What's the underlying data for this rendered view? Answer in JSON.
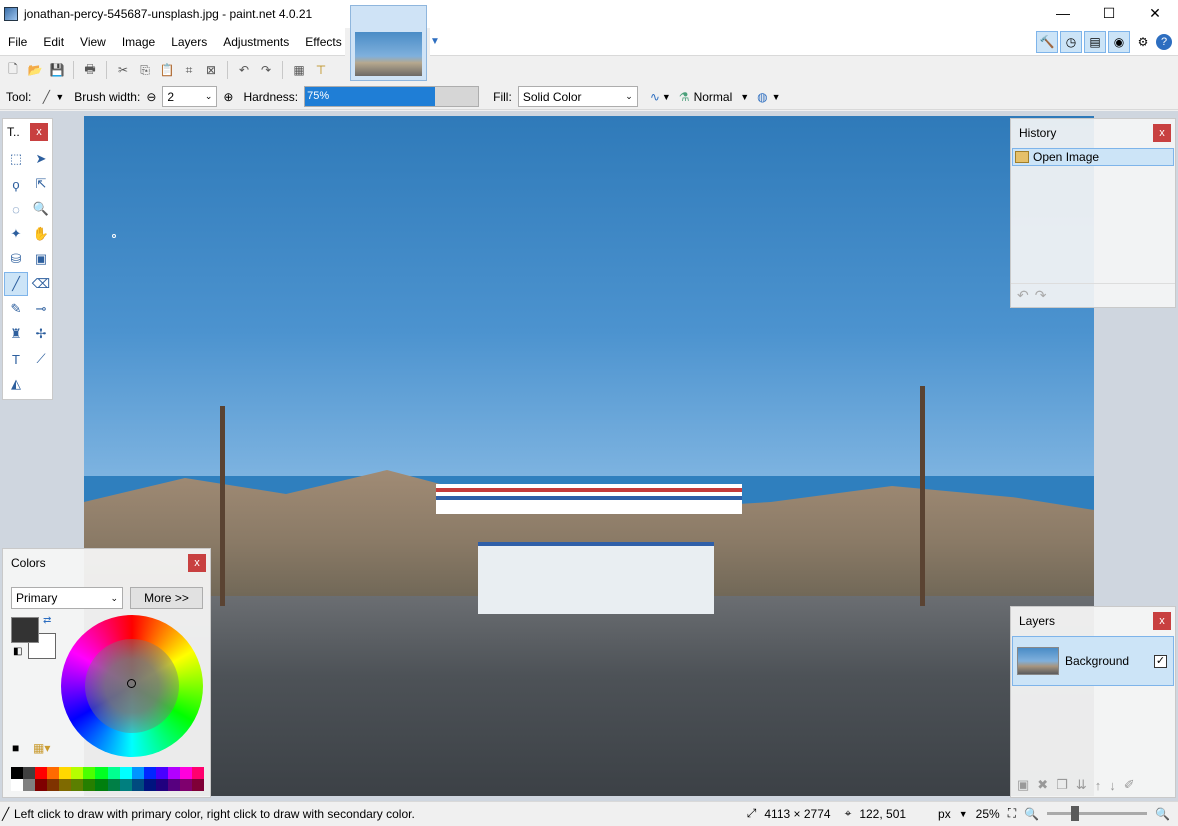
{
  "window": {
    "title": "jonathan-percy-545687-unsplash.jpg - paint.net 4.0.21",
    "minimize": "—",
    "maximize": "☐",
    "close": "✕"
  },
  "menu": [
    "File",
    "Edit",
    "View",
    "Image",
    "Layers",
    "Adjustments",
    "Effects"
  ],
  "toolbar2": {
    "tool_label": "Tool:",
    "brush_width_label": "Brush width:",
    "brush_width_value": "2",
    "hardness_label": "Hardness:",
    "hardness_value": "75%",
    "hardness_fraction": 0.75,
    "fill_label": "Fill:",
    "fill_value": "Solid Color",
    "blend_mode": "Normal"
  },
  "tools_panel": {
    "title": "T..",
    "close": "x"
  },
  "history_panel": {
    "title": "History",
    "close": "x",
    "items": [
      "Open Image"
    ]
  },
  "colors_panel": {
    "title": "Colors",
    "close": "x",
    "mode": "Primary",
    "more_button": "More >>",
    "primary_color": "#333333",
    "secondary_color": "#ffffff"
  },
  "layers_panel": {
    "title": "Layers",
    "close": "x",
    "layers": [
      {
        "name": "Background",
        "visible": true
      }
    ]
  },
  "statusbar": {
    "message": "Left click to draw with primary color, right click to draw with secondary color.",
    "image_size": "4113 × 2774",
    "cursor_pos": "122, 501",
    "units": "px",
    "zoom": "25%"
  },
  "colors": {
    "accent": "#1f7ed6",
    "selection": "#cce4f7",
    "close_red": "#c84040"
  }
}
